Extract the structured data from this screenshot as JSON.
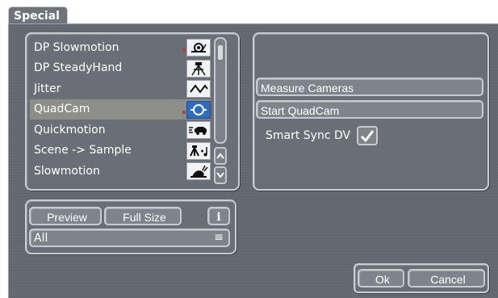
{
  "tab": {
    "label": "Special"
  },
  "effects": {
    "items": [
      {
        "label": "DP Slowmotion",
        "icon": "snail-icon",
        "selected": false,
        "marked": true
      },
      {
        "label": "DP SteadyHand",
        "icon": "tripod-icon",
        "selected": false,
        "marked": false
      },
      {
        "label": "Jitter",
        "icon": "jitter-wave-icon",
        "selected": false,
        "marked": false
      },
      {
        "label": "QuadCam",
        "icon": "quadcam-icon",
        "selected": true,
        "marked": true
      },
      {
        "label": "Quickmotion",
        "icon": "fast-car-icon",
        "selected": false,
        "marked": false
      },
      {
        "label": "Scene -> Sample",
        "icon": "scene-sample-icon",
        "selected": false,
        "marked": false
      },
      {
        "label": "Slowmotion",
        "icon": "snail-icon",
        "selected": false,
        "marked": false
      }
    ]
  },
  "settings": {
    "measure_cameras_label": "Measure Cameras",
    "start_quadcam_label": "Start QuadCam",
    "smart_sync_label": "Smart Sync DV",
    "smart_sync_checked": true
  },
  "preview": {
    "preview_label": "Preview",
    "full_size_label": "Full Size",
    "info_label": "i",
    "filter_value": "All"
  },
  "dialog": {
    "ok_label": "Ok",
    "cancel_label": "Cancel"
  },
  "colors": {
    "selected_icon_bg": "#2d6cc2",
    "marker_red": "#c0322f"
  }
}
